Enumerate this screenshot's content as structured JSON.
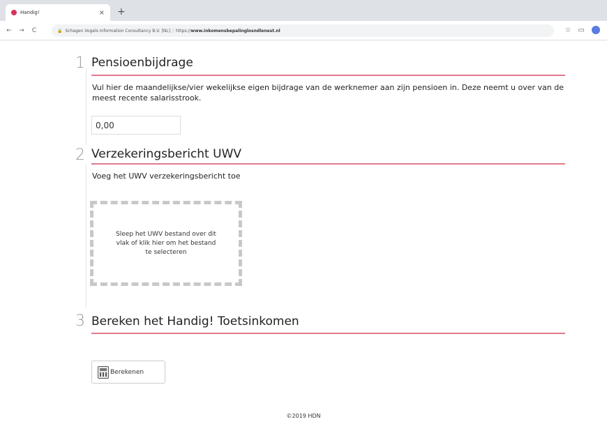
{
  "browser": {
    "tab_title": "Handig!",
    "tab_close": "×",
    "new_tab": "+",
    "back": "←",
    "forward": "→",
    "reload": "C",
    "lock": "🔒",
    "site_owner": "Schagen Vogels Information Consultancy B.V. [NL]",
    "url_prefix": "https://",
    "url_host": "www.inkomensbepalinglosndlenest.nl",
    "star": "☆",
    "cast": "▭"
  },
  "sections": [
    {
      "number": "1",
      "title": "Pensioenbijdrage",
      "description": "Vul hier de maandelijkse/vier wekelijkse eigen bijdrage van de werknemer aan zijn pensioen in. Deze neemt u over van de meest recente salarisstrook.",
      "input_value": "0,00"
    },
    {
      "number": "2",
      "title": "Verzekeringsbericht UWV",
      "description": "Voeg het UWV verzekeringsbericht toe",
      "dropzone_text": "Sleep het UWV bestand over dit vlak of klik hier om het bestand te selecteren"
    },
    {
      "number": "3",
      "title": "Bereken het Handig! Toetsinkomen",
      "button_label": "Berekenen"
    }
  ],
  "footer": "©2019 HDN",
  "colors": {
    "accent_line": "#e07a8c",
    "favicon": "#d8325a"
  }
}
